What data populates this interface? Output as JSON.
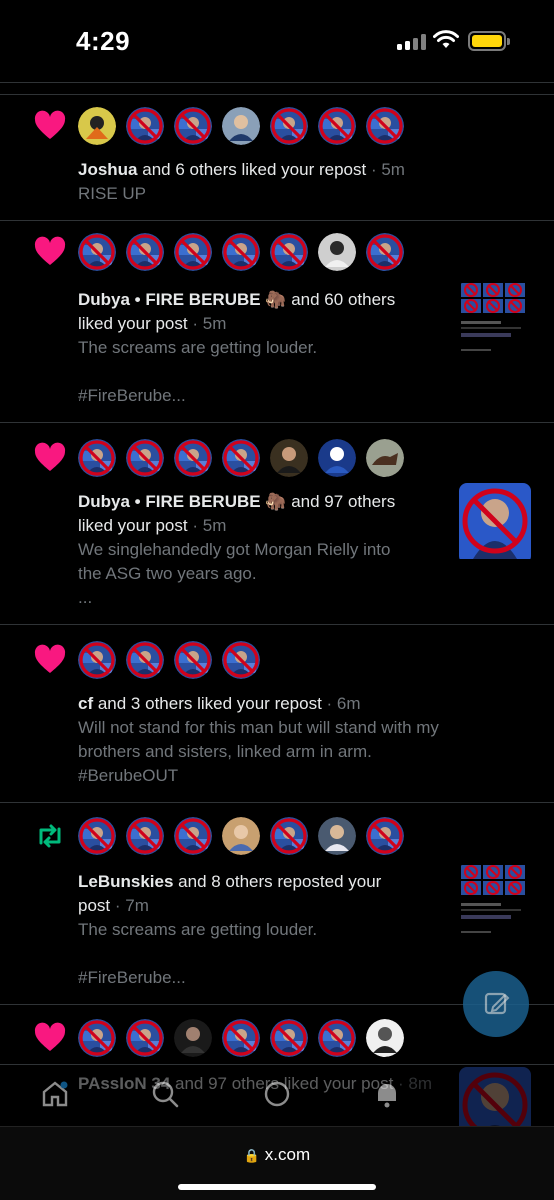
{
  "status_bar": {
    "time": "4:29"
  },
  "notifications": [
    {
      "type": "like",
      "avatars": [
        "custom1",
        "ban",
        "ban",
        "player",
        "ban",
        "ban",
        "ban"
      ],
      "user": "Joshua",
      "action": " and 6 others liked your repost",
      "time": "5m",
      "body": [
        "RISE UP"
      ],
      "thumbnail": "none"
    },
    {
      "type": "like",
      "avatars": [
        "ban",
        "ban",
        "ban",
        "ban",
        "ban",
        "player2",
        "ban"
      ],
      "user": "Dubya • FIRE BERUBE",
      "emoji": "🦣",
      "action": " and 60 others",
      "action_line2": "liked your post",
      "time": "5m",
      "body": [
        "The screams are getting louder.",
        "",
        "#FireBerube..."
      ],
      "thumbnail": "grid"
    },
    {
      "type": "like",
      "avatars": [
        "ban",
        "ban",
        "ban",
        "ban",
        "person",
        "team",
        "horse"
      ],
      "user": "Dubya • FIRE BERUBE",
      "emoji": "🦣",
      "action": " and 97 others",
      "action_line2": "liked your post",
      "time": "5m",
      "body": [
        "We singlehandedly got Morgan Rielly into",
        "the ASG two years ago.",
        "..."
      ],
      "thumbnail": "ban-large"
    },
    {
      "type": "like",
      "avatars": [
        "ban",
        "ban",
        "ban",
        "ban"
      ],
      "user": "cf",
      "action": " and 3 others liked your repost",
      "time": "6m",
      "body": [
        "Will not stand for this man but will stand with my",
        "brothers and sisters, linked arm in arm.",
        "#BerubeOUT"
      ],
      "thumbnail": "none"
    },
    {
      "type": "repost",
      "avatars": [
        "ban",
        "ban",
        "ban",
        "woman",
        "ban",
        "player3",
        "ban"
      ],
      "user": "LeBunskies",
      "action": " and 8 others reposted your",
      "action_line2": "post",
      "time": "7m",
      "body": [
        "The screams are getting louder.",
        "",
        "#FireBerube..."
      ],
      "thumbnail": "grid"
    },
    {
      "type": "like",
      "avatars": [
        "ban",
        "ban",
        "dark",
        "ban",
        "ban",
        "ban",
        "bw"
      ],
      "user": "PAssIoN 34",
      "action": " and 97 others liked your post",
      "time": "8m",
      "body": [],
      "thumbnail": "ban-large"
    }
  ],
  "tabs": [
    "home-icon",
    "search-icon",
    "spaces-icon",
    "notifications-icon"
  ],
  "browser": {
    "url": "x.com"
  },
  "colors": {
    "like": "#f91880",
    "repost": "#00ba7c",
    "muted": "#71767b",
    "ban_red": "#d0021b",
    "compose": "#1d9bf0"
  }
}
